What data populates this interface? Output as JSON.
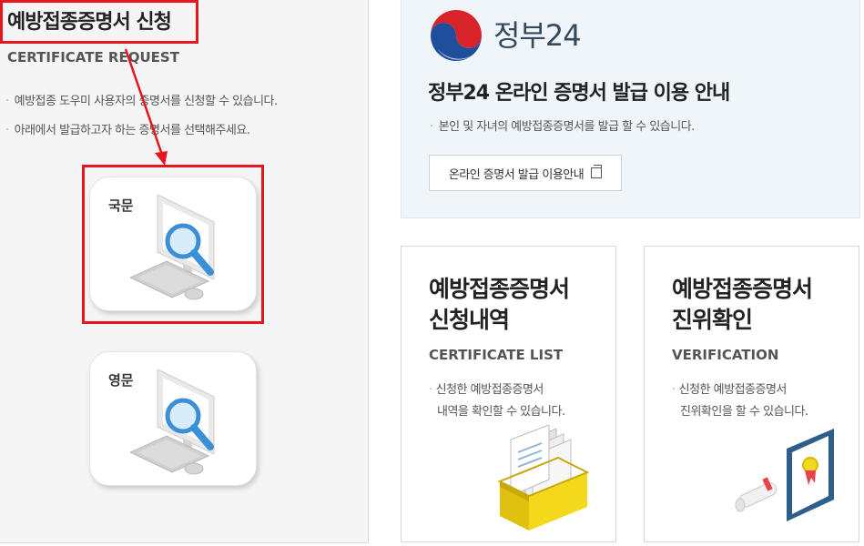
{
  "left": {
    "title": "예방접종증명서 신청",
    "subtitle": "CERTIFICATE REQUEST",
    "notes": [
      "예방접종 도우미 사용자의 증명서를 신청할 수 있습니다.",
      "아래에서 발급하고자 하는 증명서를 선택해주세요."
    ],
    "cards": [
      {
        "label": "국문",
        "icon": "computer-magnifier-icon"
      },
      {
        "label": "영문",
        "icon": "computer-magnifier-icon"
      }
    ]
  },
  "gov24": {
    "name": "정부24",
    "heading": "정부24 온라인 증명서 발급 이용 안내",
    "note": "본인 및 자녀의 예방접종증명서를 발급 할 수 있습니다.",
    "button": "온라인 증명서 발급 이용안내",
    "button_icon": "new-window-icon"
  },
  "menu": [
    {
      "title_lines": [
        "예방접종증명서",
        "신청내역"
      ],
      "subtitle": "CERTIFICATE LIST",
      "desc_lines": [
        "신청한 예방접종증명서",
        "내역을 확인할 수 있습니다."
      ],
      "icon": "document-box-icon"
    },
    {
      "title_lines": [
        "예방접종증명서",
        "진위확인"
      ],
      "subtitle": "VERIFICATION",
      "desc_lines": [
        "신청한 예방접종증명서",
        "진위확인을 할 수 있습니다."
      ],
      "icon": "certificate-frame-icon"
    }
  ],
  "colors": {
    "highlight": "#e5161d",
    "magnifier": "#3a8fd6",
    "box_yellow": "#f4d81c",
    "frame_blue": "#2e5f8a"
  }
}
